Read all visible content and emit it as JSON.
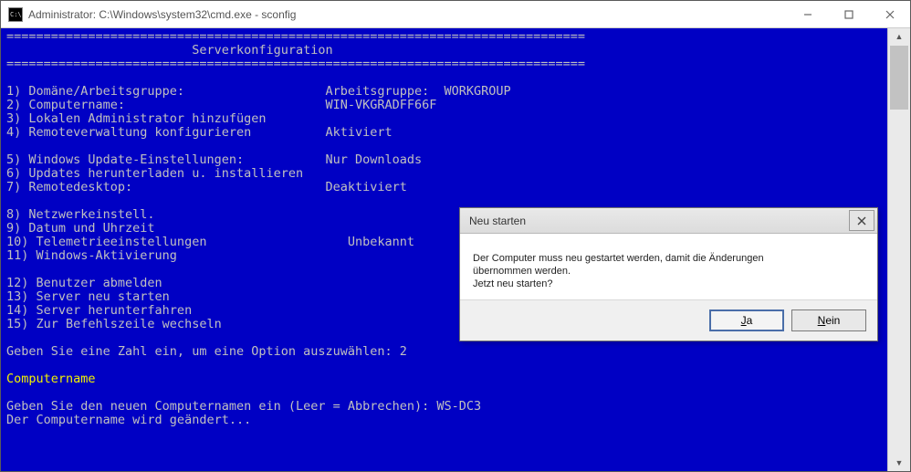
{
  "window": {
    "title": "Administrator: C:\\Windows\\system32\\cmd.exe - sconfig"
  },
  "console": {
    "divider": "==============================================================================",
    "header": "                         Serverkonfiguration",
    "items": [
      {
        "n": "1)",
        "label": "Domäne/Arbeitsgruppe:",
        "value": "Arbeitsgruppe:  WORKGROUP"
      },
      {
        "n": "2)",
        "label": "Computername:",
        "value": "WIN-VKGRADFF66F"
      },
      {
        "n": "3)",
        "label": "Lokalen Administrator hinzufügen",
        "value": ""
      },
      {
        "n": "4)",
        "label": "Remoteverwaltung konfigurieren",
        "value": "Aktiviert"
      },
      {
        "n": "",
        "label": "",
        "value": ""
      },
      {
        "n": "5)",
        "label": "Windows Update-Einstellungen:",
        "value": "Nur Downloads"
      },
      {
        "n": "6)",
        "label": "Updates herunterladen u. installieren",
        "value": ""
      },
      {
        "n": "7)",
        "label": "Remotedesktop:",
        "value": "Deaktiviert"
      },
      {
        "n": "",
        "label": "",
        "value": ""
      },
      {
        "n": "8)",
        "label": "Netzwerkeinstell.",
        "value": ""
      },
      {
        "n": "9)",
        "label": "Datum und Uhrzeit",
        "value": ""
      },
      {
        "n": "10)",
        "label": "Telemetrieeinstellungen",
        "value": "   Unbekannt"
      },
      {
        "n": "11)",
        "label": "Windows-Aktivierung",
        "value": ""
      },
      {
        "n": "",
        "label": "",
        "value": ""
      },
      {
        "n": "12)",
        "label": "Benutzer abmelden",
        "value": ""
      },
      {
        "n": "13)",
        "label": "Server neu starten",
        "value": ""
      },
      {
        "n": "14)",
        "label": "Server herunterfahren",
        "value": ""
      },
      {
        "n": "15)",
        "label": "Zur Befehlszeile wechseln",
        "value": ""
      }
    ],
    "prompt1": "Geben Sie eine Zahl ein, um eine Option auszuwählen: 2",
    "section": "Computername",
    "prompt2": "Geben Sie den neuen Computernamen ein (Leer = Abbrechen): WS-DC3",
    "status": "Der Computername wird geändert..."
  },
  "dialog": {
    "title": "Neu starten",
    "line1": "Der Computer muss neu gestartet werden, damit die Änderungen",
    "line2": "übernommen werden.",
    "line3": "Jetzt neu starten?",
    "yes": {
      "u": "J",
      "rest": "a"
    },
    "no": {
      "u": "N",
      "rest": "ein"
    }
  }
}
